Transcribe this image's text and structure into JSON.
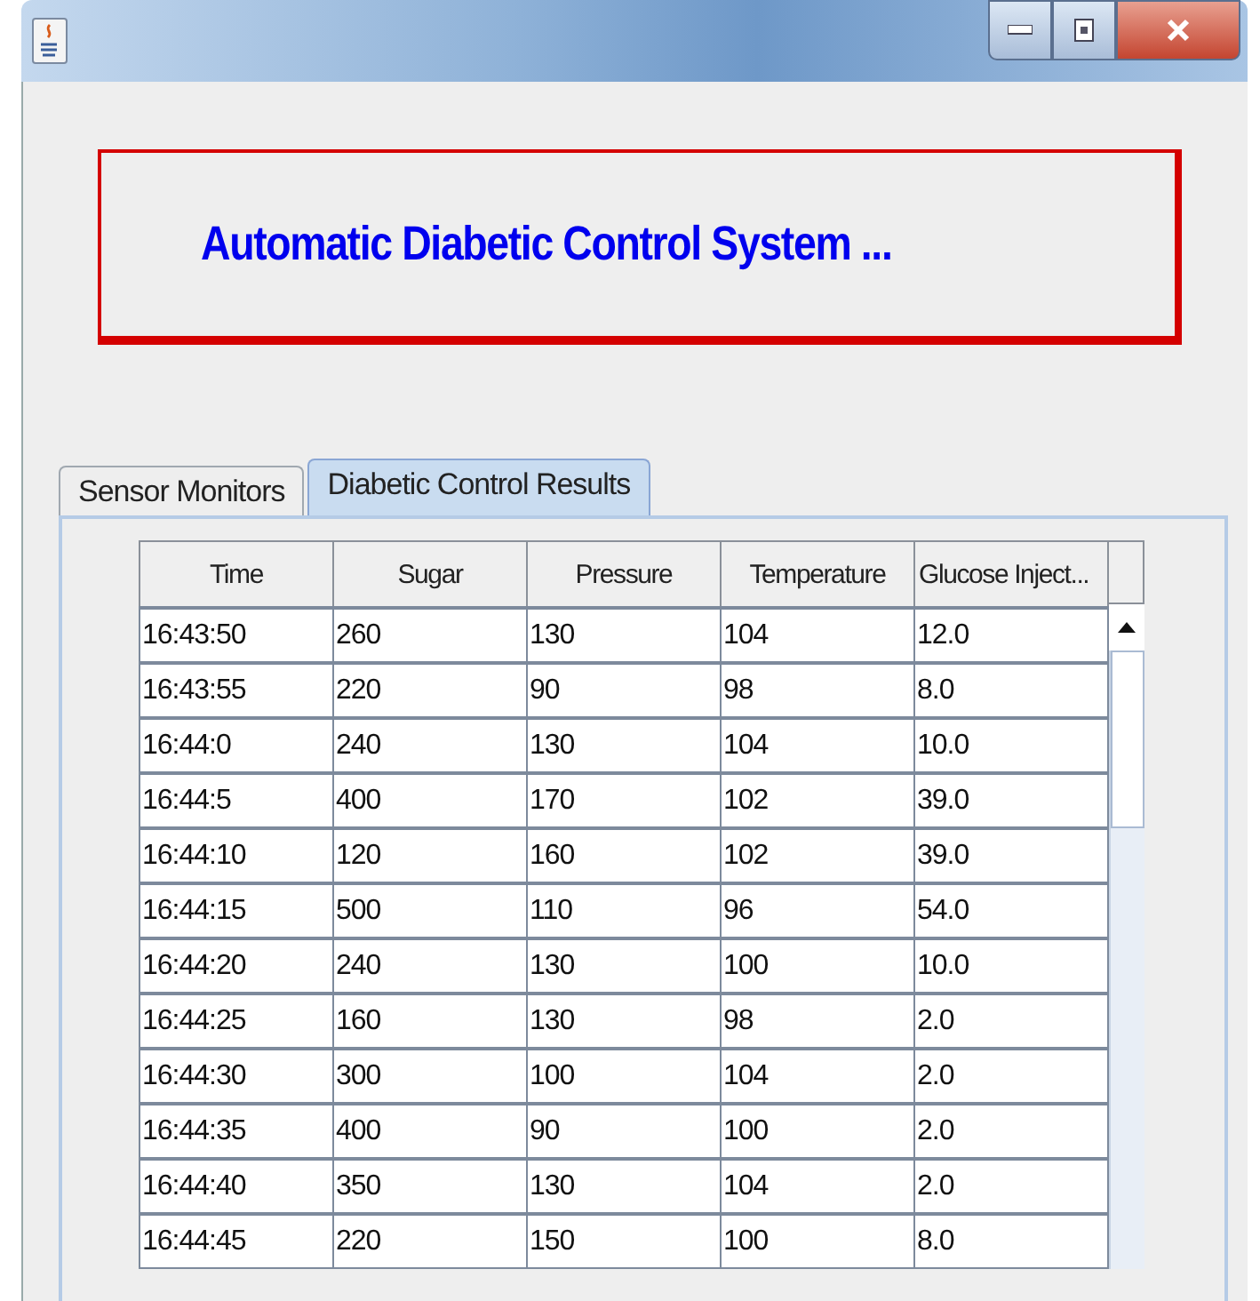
{
  "banner": {
    "title": "Automatic Diabetic Control System ..."
  },
  "tabs": [
    {
      "label": "Sensor Monitors",
      "selected": false
    },
    {
      "label": "Diabetic Control Results",
      "selected": true
    }
  ],
  "table": {
    "columns": [
      "Time",
      "Sugar",
      "Pressure",
      "Temperature",
      "Glucose Inject..."
    ],
    "rows": [
      [
        "16:43:50",
        "260",
        "130",
        "104",
        "12.0"
      ],
      [
        "16:43:55",
        "220",
        "90",
        "98",
        "8.0"
      ],
      [
        "16:44:0",
        "240",
        "130",
        "104",
        "10.0"
      ],
      [
        "16:44:5",
        "400",
        "170",
        "102",
        "39.0"
      ],
      [
        "16:44:10",
        "120",
        "160",
        "102",
        "39.0"
      ],
      [
        "16:44:15",
        "500",
        "110",
        "96",
        "54.0"
      ],
      [
        "16:44:20",
        "240",
        "130",
        "100",
        "10.0"
      ],
      [
        "16:44:25",
        "160",
        "130",
        "98",
        "2.0"
      ],
      [
        "16:44:30",
        "300",
        "100",
        "104",
        "2.0"
      ],
      [
        "16:44:35",
        "400",
        "90",
        "100",
        "2.0"
      ],
      [
        "16:44:40",
        "350",
        "130",
        "104",
        "2.0"
      ],
      [
        "16:44:45",
        "220",
        "150",
        "100",
        "8.0"
      ]
    ]
  }
}
